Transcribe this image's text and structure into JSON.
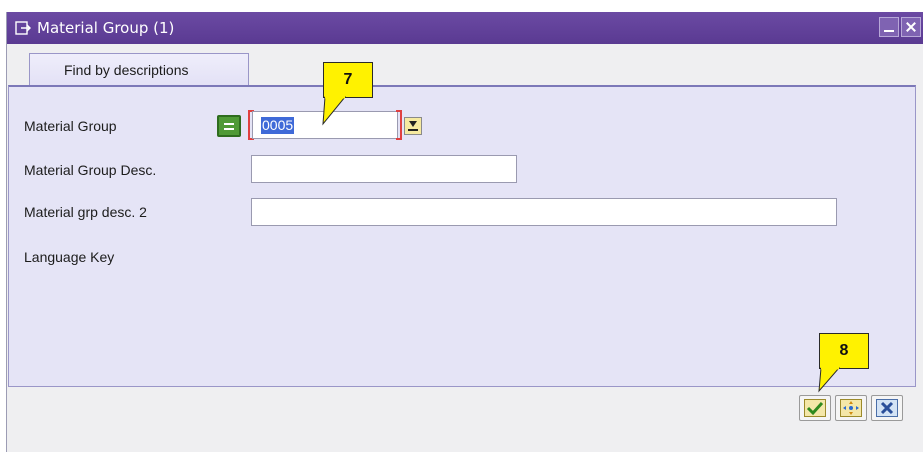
{
  "window": {
    "title": "Material Group (1)"
  },
  "tabs": [
    {
      "label": "Find by descriptions"
    }
  ],
  "fields": {
    "material_group": {
      "label": "Material Group",
      "value": "0005"
    },
    "material_group_desc": {
      "label": "Material Group Desc.",
      "value": ""
    },
    "material_grp_desc2": {
      "label": "Material grp desc. 2",
      "value": ""
    },
    "language_key": {
      "label": "Language Key"
    }
  },
  "callouts": {
    "step7": "7",
    "step8": "8"
  },
  "icons": {
    "title": "dialog-icon",
    "operator": "equals-icon",
    "search_help": "search-help-icon",
    "continue": "checkmark-icon",
    "multiple_selection": "multiple-selection-icon",
    "cancel": "cancel-icon"
  },
  "colors": {
    "titlebar": "#5a3a92",
    "panel": "#e5e4f6",
    "callout": "#fff200",
    "selection": "#3f6ad8"
  }
}
